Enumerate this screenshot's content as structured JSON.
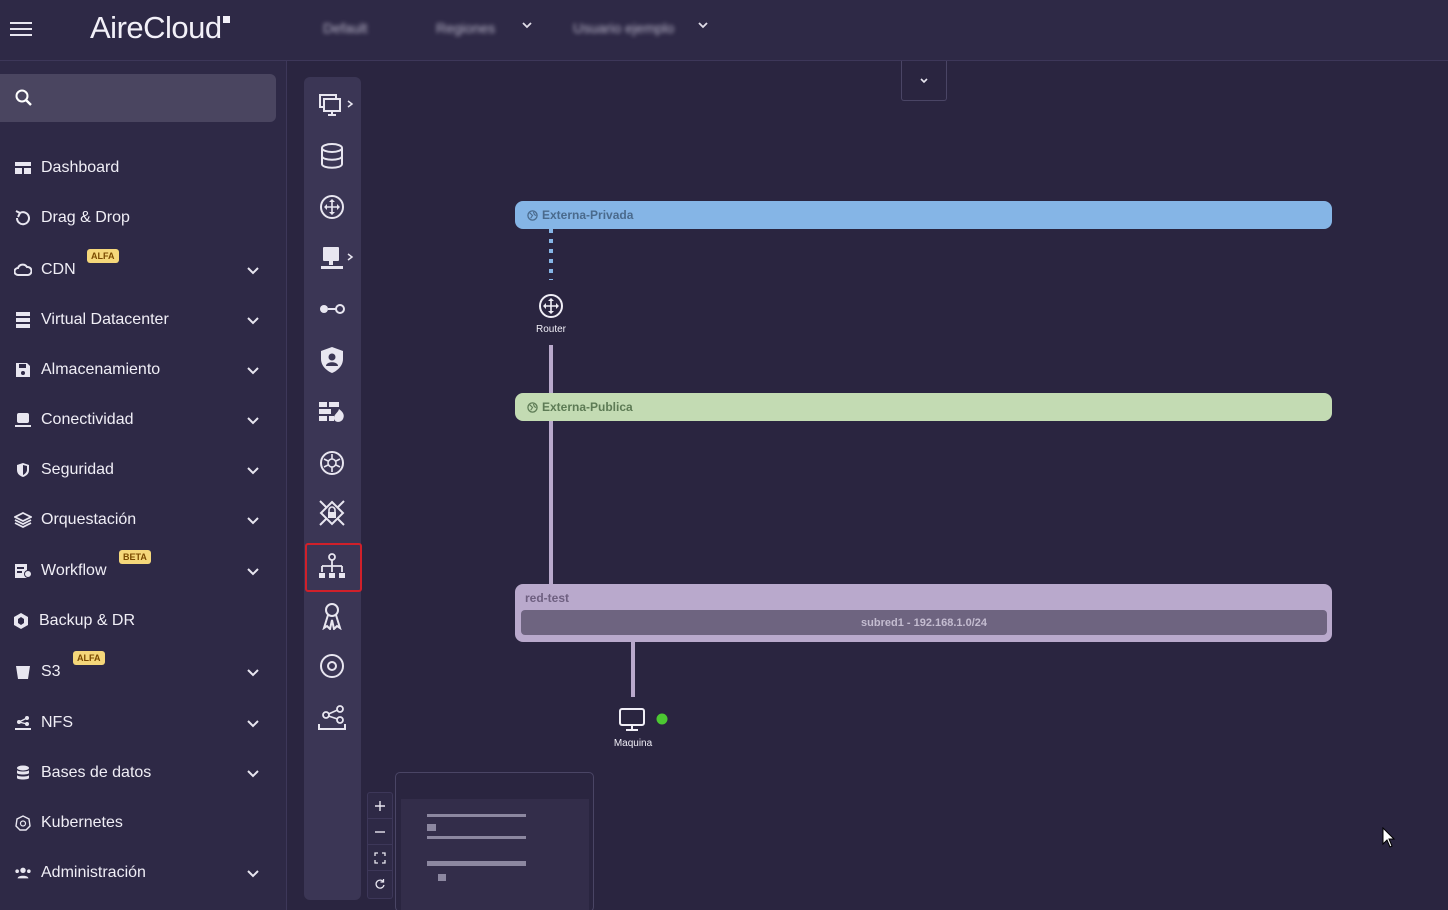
{
  "app": {
    "brand": "AireCloud"
  },
  "topbar": {
    "project": "Default",
    "region": "Regiones",
    "user": "Usuario ejemplo"
  },
  "search": {
    "placeholder": ""
  },
  "sidebar": {
    "items": [
      {
        "label": "Dashboard",
        "icon": "dashboard-icon",
        "has_chevron": false
      },
      {
        "label": "Drag & Drop",
        "icon": "drag-drop-icon",
        "has_chevron": false
      },
      {
        "label": "CDN",
        "icon": "cloud-icon",
        "has_chevron": true,
        "badge": "ALFA"
      },
      {
        "label": "Virtual Datacenter",
        "icon": "server-icon",
        "has_chevron": true
      },
      {
        "label": "Almacenamiento",
        "icon": "save-icon",
        "has_chevron": true
      },
      {
        "label": "Conectividad",
        "icon": "network-icon",
        "has_chevron": true
      },
      {
        "label": "Seguridad",
        "icon": "shield-icon",
        "has_chevron": true
      },
      {
        "label": "Orquestación",
        "icon": "layers-icon",
        "has_chevron": true
      },
      {
        "label": "Workflow",
        "icon": "workflow-icon",
        "has_chevron": true,
        "badge": "BETA"
      },
      {
        "label": "Backup & DR",
        "icon": "backup-icon",
        "has_chevron": false
      },
      {
        "label": "S3",
        "icon": "bucket-icon",
        "has_chevron": true,
        "badge": "ALFA"
      },
      {
        "label": "NFS",
        "icon": "nfs-icon",
        "has_chevron": true
      },
      {
        "label": "Bases de datos",
        "icon": "database-icon",
        "has_chevron": true
      },
      {
        "label": "Kubernetes",
        "icon": "kubernetes-icon",
        "has_chevron": false
      },
      {
        "label": "Administración",
        "icon": "users-icon",
        "has_chevron": true
      }
    ]
  },
  "toolbar": {
    "tools": [
      "monitor-icon",
      "database-icon",
      "router-icon",
      "desktop-icon",
      "key-link-icon",
      "shield-user-icon",
      "firewall-icon",
      "kubernetes-icon",
      "vpn-icon",
      "network-topology-icon",
      "badge-icon",
      "disk-icon",
      "share-icon"
    ],
    "selected": "network-topology-icon"
  },
  "diagram": {
    "networks": {
      "private": "Externa-Privada",
      "public": "Externa-Publica",
      "internal": "red-test",
      "subnet": "subred1 - 192.168.1.0/24"
    },
    "router_label": "Router",
    "machine_label": "Maquina",
    "machine_status_color": "#4cc832"
  },
  "colors": {
    "accent_selected": "#d0202a",
    "private_net": "#85b5e6",
    "public_net": "#c3dbb3",
    "internal_net": "#b9a9cc"
  }
}
